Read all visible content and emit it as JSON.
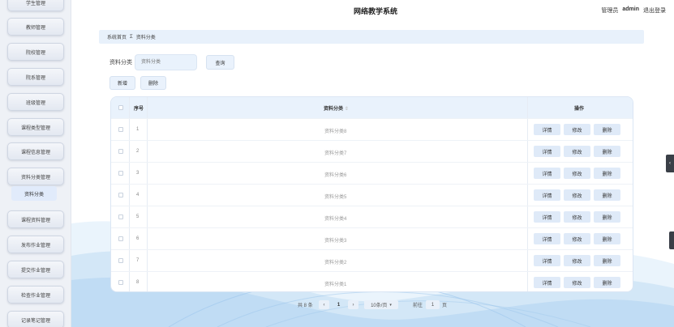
{
  "header": {
    "title": "网络教学系统",
    "role": "管理员",
    "username": "admin",
    "logout": "退出登录"
  },
  "sidebar": {
    "items": [
      {
        "label": "学生管理"
      },
      {
        "label": "教师管理"
      },
      {
        "label": "院校管理"
      },
      {
        "label": "院系管理"
      },
      {
        "label": "班级管理"
      },
      {
        "label": "课程类型管理"
      },
      {
        "label": "课程信息管理"
      },
      {
        "label": "资料分类管理"
      },
      {
        "label": "课程资料管理"
      },
      {
        "label": "发布作业管理"
      },
      {
        "label": "提交作业管理"
      },
      {
        "label": "检查作业管理"
      },
      {
        "label": "记录笔记管理"
      }
    ],
    "active_sub": "资料分类"
  },
  "breadcrumb": {
    "home": "系统首页",
    "separator": "Σ",
    "current": "资料分类"
  },
  "search": {
    "label": "资料分类",
    "placeholder": "资料分类",
    "query_button": "查询"
  },
  "toolbar": {
    "add_button": "新增",
    "delete_button": "删除"
  },
  "table": {
    "headers": {
      "index": "序号",
      "name": "资料分类",
      "sort_icon": "⇕",
      "ops": "操作"
    },
    "rows": [
      {
        "index": "1",
        "name": "资料分类8"
      },
      {
        "index": "2",
        "name": "资料分类7"
      },
      {
        "index": "3",
        "name": "资料分类6"
      },
      {
        "index": "4",
        "name": "资料分类5"
      },
      {
        "index": "5",
        "name": "资料分类4"
      },
      {
        "index": "6",
        "name": "资料分类3"
      },
      {
        "index": "7",
        "name": "资料分类2"
      },
      {
        "index": "8",
        "name": "资料分类1"
      }
    ],
    "row_actions": {
      "detail": "详情",
      "edit": "修改",
      "delete": "删除"
    }
  },
  "pagination": {
    "total": "共 8 条",
    "prev": "‹",
    "page": "1",
    "next": "›",
    "page_size": "10条/页",
    "goto_label": "前往",
    "goto_value": "1",
    "goto_suffix": "页"
  },
  "icons": {
    "collapse": "chevron-left-icon"
  },
  "colors": {
    "accent": "#e9f2fc",
    "sidebar_bg": "#eef1f6",
    "wave": "#bcd9f2"
  }
}
